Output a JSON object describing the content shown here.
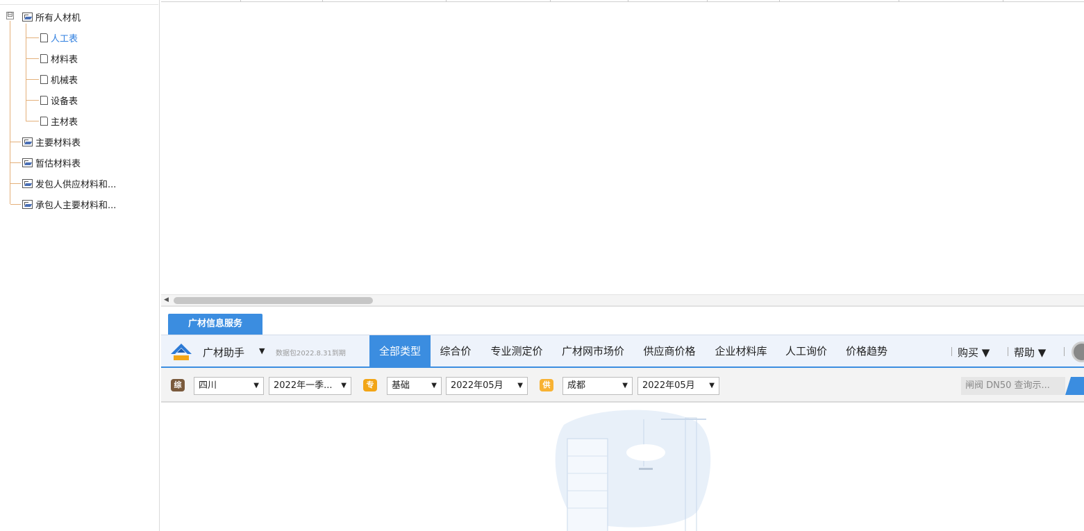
{
  "tree": {
    "root_label": "所有人材机",
    "expander": "⊟",
    "children": [
      "人工表",
      "材料表",
      "机械表",
      "设备表",
      "主材表"
    ],
    "siblings": [
      "主要材料表",
      "暂估材料表",
      "发包人供应材料和...",
      "承包人主要材料和..."
    ]
  },
  "service": {
    "tab_label": "广材信息服务",
    "brand": "广材助手",
    "brand_arrow": "▼",
    "package_note": "数据包2022.8.31到期",
    "tabs": [
      "全部类型",
      "综合价",
      "专业测定价",
      "广材网市场价",
      "供应商价格",
      "企业材料库",
      "人工询价",
      "价格趋势"
    ],
    "active_tab": "全部类型",
    "buy": "购买 ▼",
    "help": "帮助 ▼"
  },
  "filters": {
    "badge_comp": "综",
    "province": "四川",
    "period": "2022年一季...",
    "badge_spec": "专",
    "category": "基础",
    "spec_month": "2022年05月",
    "badge_supply": "供",
    "city": "成都",
    "supply_month": "2022年05月",
    "search_placeholder": "闸阀 DN50 查询示..."
  },
  "colors": {
    "accent": "#3b8de0",
    "active_tree_text": "#2f7fe0",
    "tree_line": "#e4b07a"
  }
}
